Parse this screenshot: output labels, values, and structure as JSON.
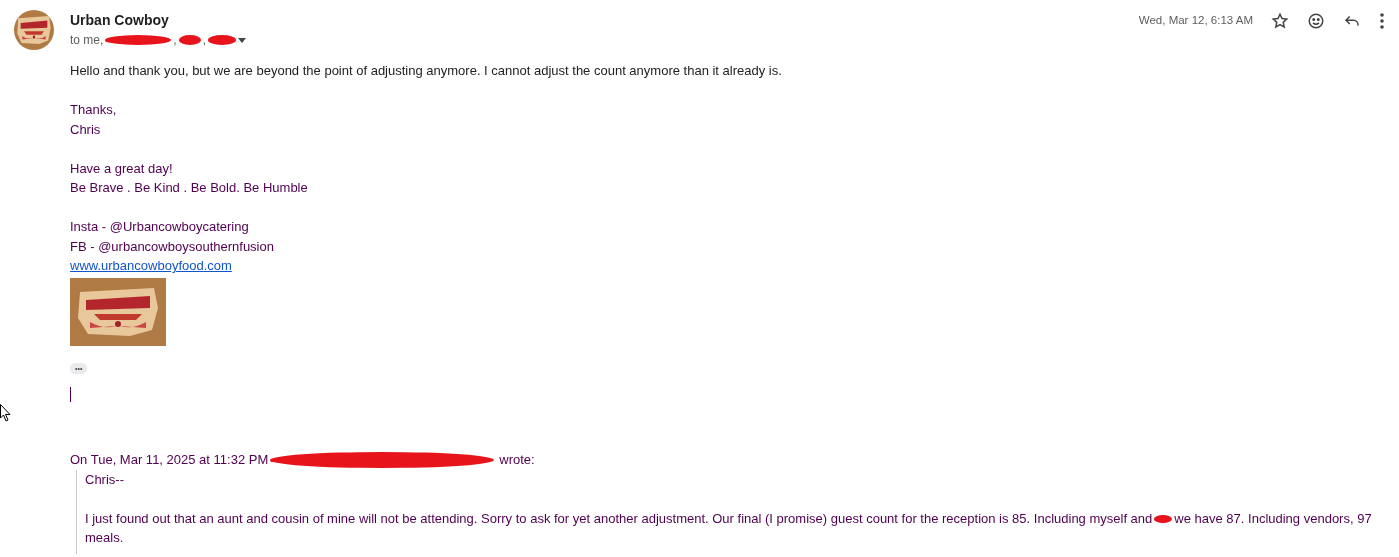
{
  "sender": {
    "name": "Urban Cowboy",
    "to_prefix": "to me,",
    "separators": [
      ",",
      ","
    ]
  },
  "date": "Wed, Mar 12, 6:13 AM",
  "body": {
    "greeting": "Hello and thank you, but we are beyond the point of adjusting anymore. I cannot adjust the count anymore than it already is.",
    "signoff": [
      "Thanks,",
      "Chris"
    ],
    "motto": [
      "Have a great day!",
      "Be Brave . Be Kind . Be Bold. Be Humble"
    ],
    "social": [
      "Insta - @Urbancowboycatering",
      "FB - @urbancowboysouthernfusion"
    ],
    "link": "www.urbancowboyfood.com",
    "ellipsis": "•••"
  },
  "quote": {
    "header_prefix": "On Tue, Mar 11, 2025 at 11:32 PM",
    "header_suffix": "wrote:",
    "salutation": "Chris--",
    "text_before": "I just found out that an aunt and cousin of mine will not be attending. Sorry to ask for yet another adjustment. Our final (I promise) guest count for the reception is 85. Including myself and",
    "text_after": "we have 87. Including vendors, 97 meals."
  }
}
